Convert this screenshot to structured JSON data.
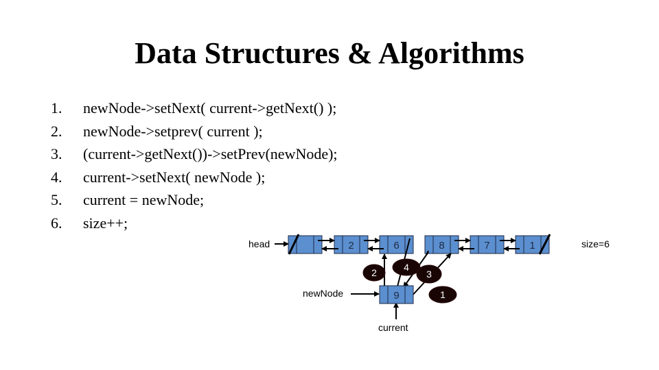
{
  "slide": {
    "title": "Data Structures & Algorithms",
    "code_lines": [
      {
        "num": "1.",
        "text": "newNode->setNext( current->getNext() );"
      },
      {
        "num": "2.",
        "text": "newNode->setprev( current );"
      },
      {
        "num": "3.",
        "text": "(current->getNext())->setPrev(newNode);"
      },
      {
        "num": "4.",
        "text": "current->setNext( newNode );"
      },
      {
        "num": "5.",
        "text": "current = newNode;"
      },
      {
        "num": "6.",
        "text": "size++;"
      }
    ]
  },
  "diagram": {
    "head_label": "head",
    "size_label": "size=6",
    "newnode_label": "newNode",
    "current_label": "current",
    "list_nodes": [
      {
        "value": "",
        "null_prev": true,
        "null_next": false
      },
      {
        "value": "2",
        "null_prev": false,
        "null_next": false
      },
      {
        "value": "6",
        "null_prev": false,
        "null_next": false
      },
      {
        "value": "8",
        "null_prev": false,
        "null_next": false
      },
      {
        "value": "7",
        "null_prev": false,
        "null_next": false
      },
      {
        "value": "1",
        "null_prev": false,
        "null_next": true
      }
    ],
    "new_node": {
      "value": "9"
    },
    "step_callouts": [
      "2",
      "4",
      "3",
      "1"
    ],
    "colors": {
      "node_fill": "#5b8fcf",
      "node_border": "#1f2a44",
      "callout_fill": "#1a0505",
      "arrow": "#000000"
    }
  }
}
